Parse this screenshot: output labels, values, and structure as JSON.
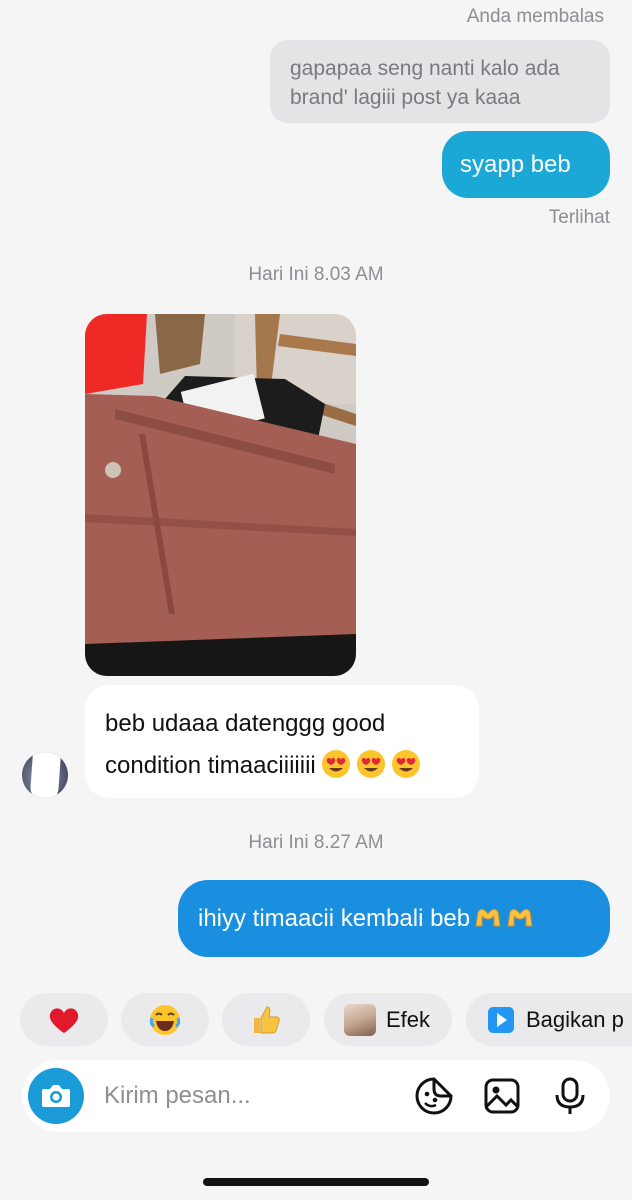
{
  "thread": {
    "reply_label": "Anda membalas",
    "quoted_text": "gapapaa seng nanti kalo ada brand' lagiii post ya kaaa",
    "msg_out_1": "syapp beb",
    "seen_label": "Terlihat",
    "timestamp_1": "Hari Ini 8.03 AM",
    "msg_in_1": "beb udaaa datenggg good condition timaaciiiiiii",
    "msg_in_1_emoji": "heart-eyes-face x3",
    "timestamp_2": "Hari Ini 8.27 AM",
    "msg_out_2": "ihiyy timaacii kembali beb",
    "msg_out_2_emoji": "heart-hands x2"
  },
  "quick_replies": {
    "items": [
      "heart-emoji",
      "laughing-emoji",
      "thumbs-up-emoji"
    ],
    "efek_label": "Efek",
    "share_label": "Bagikan p"
  },
  "composer": {
    "placeholder": "Kirim pesan...",
    "icons": [
      "camera-icon",
      "sticker-icon",
      "gallery-icon",
      "microphone-icon"
    ]
  },
  "colors": {
    "outgoing_bubble_1": "#1ba8d6",
    "outgoing_bubble_2": "#1a8fe0",
    "background": "#f5f5f6"
  }
}
